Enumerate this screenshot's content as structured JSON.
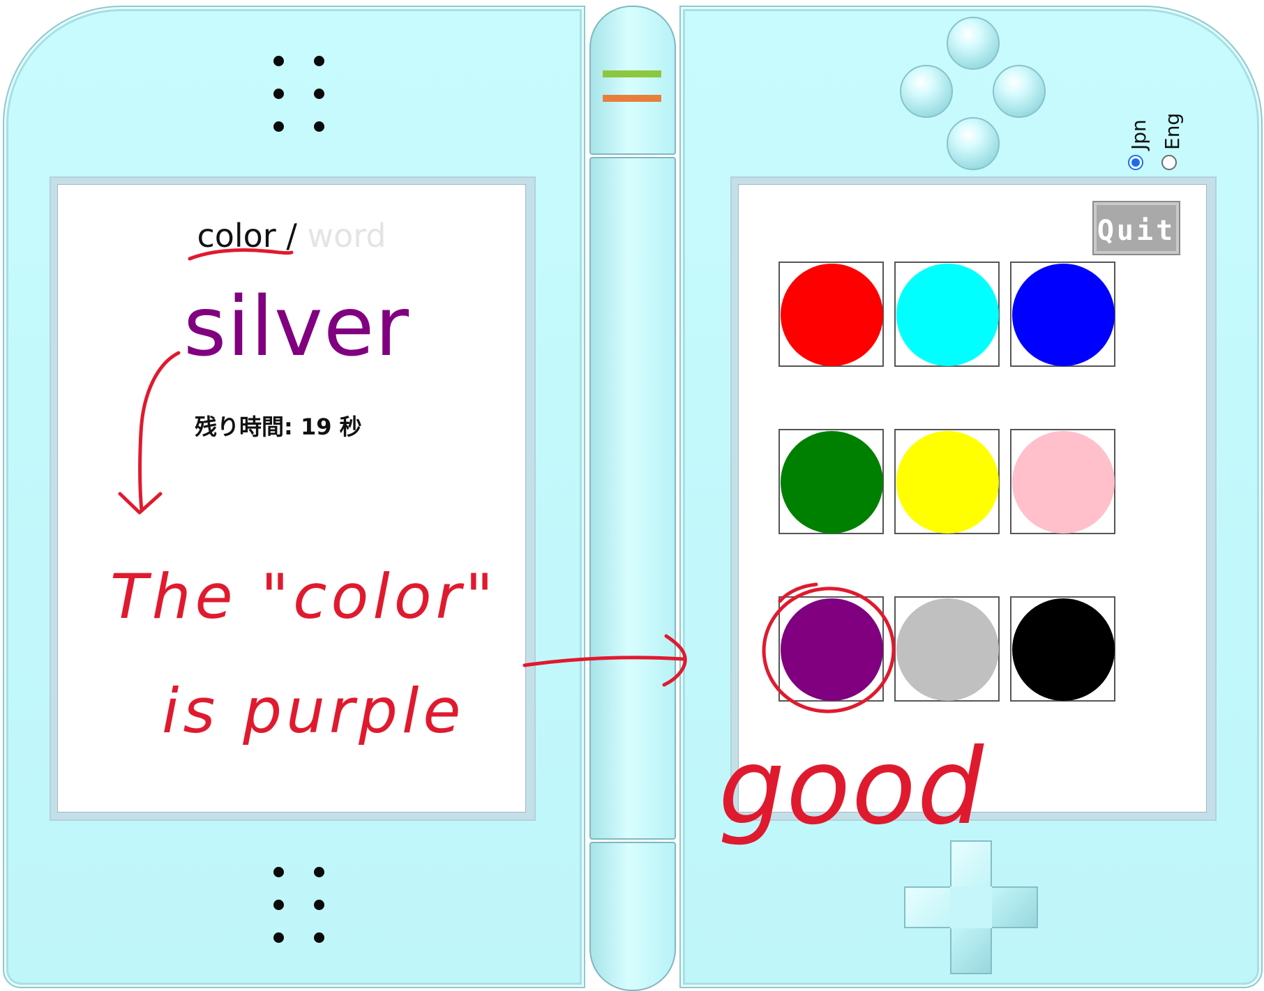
{
  "left_screen": {
    "mode_active": "color",
    "mode_separator": " /",
    "mode_inactive": " word",
    "stimulus_word": "silver",
    "timer_text": "残り時間: 19 秒"
  },
  "right_screen": {
    "quit_label": "Quit",
    "swatches": [
      {
        "color_name": "red",
        "hex": "#ff0000"
      },
      {
        "color_name": "cyan",
        "hex": "#00ffff"
      },
      {
        "color_name": "blue",
        "hex": "#0000ff"
      },
      {
        "color_name": "green",
        "hex": "#008000"
      },
      {
        "color_name": "yellow",
        "hex": "#ffff00"
      },
      {
        "color_name": "pink",
        "hex": "#ffc0cb"
      },
      {
        "color_name": "purple",
        "hex": "#800080"
      },
      {
        "color_name": "silver",
        "hex": "#c0c0c0"
      },
      {
        "color_name": "black",
        "hex": "#000000"
      }
    ]
  },
  "language": {
    "options": [
      {
        "label": "Jpn",
        "selected": true
      },
      {
        "label": "Eng",
        "selected": false
      }
    ]
  },
  "annotations": {
    "line1": "The \"color\"",
    "line2": "is purple",
    "feedback": "good",
    "ink_color": "#e01a2e"
  },
  "device": {
    "body_color": "#c2f8fb",
    "hinge_stripe_colors": [
      "#8dc63f",
      "#e87e3c"
    ]
  }
}
